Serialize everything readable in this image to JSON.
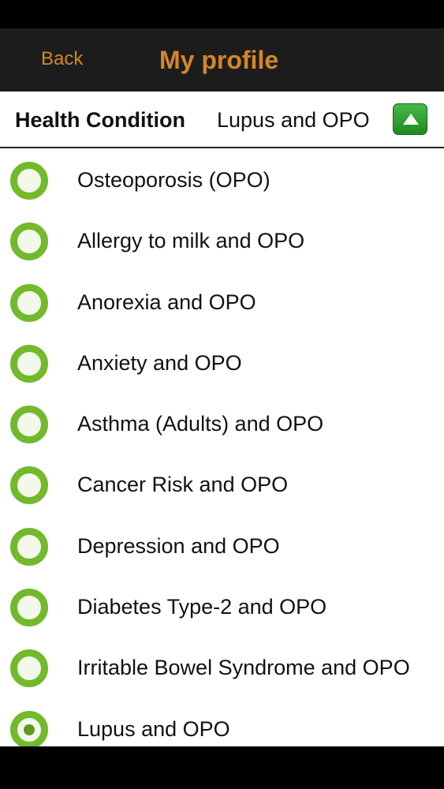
{
  "nav": {
    "back_label": "Back",
    "title": "My profile",
    "accent_color": "#d4862a"
  },
  "condition": {
    "label": "Health Condition",
    "value": "Lupus and OPO",
    "toggle_icon": "chevron-up-icon"
  },
  "conditions": {
    "selected_color": "#72b92c",
    "items": [
      {
        "label": "Osteoporosis (OPO)",
        "selected": false
      },
      {
        "label": "Allergy to milk and OPO",
        "selected": false
      },
      {
        "label": "Anorexia and OPO",
        "selected": false
      },
      {
        "label": "Anxiety and OPO",
        "selected": false
      },
      {
        "label": "Asthma (Adults) and OPO",
        "selected": false
      },
      {
        "label": "Cancer Risk and OPO",
        "selected": false
      },
      {
        "label": "Depression and OPO",
        "selected": false
      },
      {
        "label": "Diabetes Type-2 and OPO",
        "selected": false
      },
      {
        "label": "Irritable Bowel Syndrome and OPO",
        "selected": false
      },
      {
        "label": "Lupus and OPO",
        "selected": true
      }
    ]
  }
}
